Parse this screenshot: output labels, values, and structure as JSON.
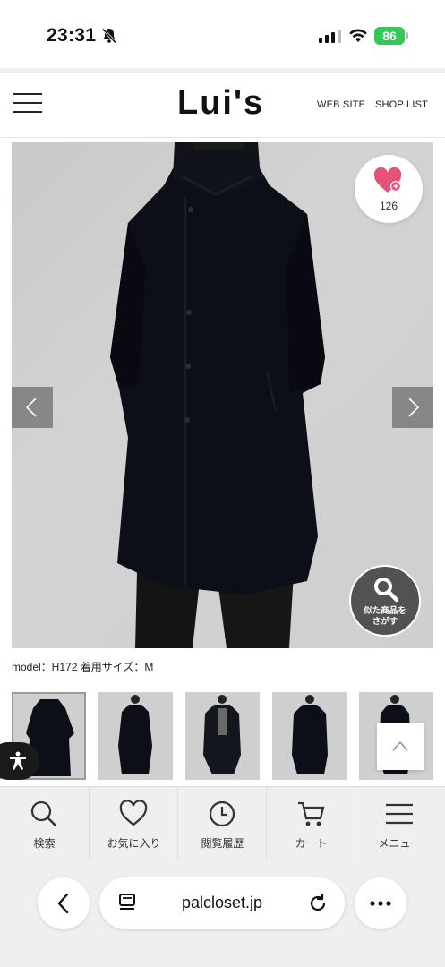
{
  "status_bar": {
    "time": "23:31",
    "battery": "86",
    "battery_color": "#34c759"
  },
  "header": {
    "logo": "Lui's",
    "nav": {
      "website": "WEB SITE",
      "shop_list": "SHOP LIST"
    }
  },
  "product": {
    "like_count": "126",
    "like_color": "#e8507a",
    "similar_label_line1": "似た商品を",
    "similar_label_line2": "さがす",
    "model_info": "model：H172 着用サイズ：M",
    "thumbnail_count": 5
  },
  "bottom_nav": {
    "items": [
      {
        "label": "検索",
        "icon": "search-icon"
      },
      {
        "label": "お気に入り",
        "icon": "heart-icon"
      },
      {
        "label": "閲覧履歴",
        "icon": "clock-icon"
      },
      {
        "label": "カート",
        "icon": "cart-icon"
      },
      {
        "label": "メニュー",
        "icon": "menu-icon"
      }
    ]
  },
  "browser": {
    "url": "palcloset.jp"
  }
}
